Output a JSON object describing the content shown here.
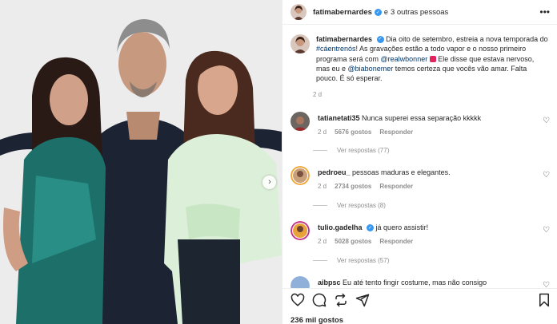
{
  "header": {
    "username": "fatimabernardes",
    "separator": "e",
    "others": "3 outras pessoas"
  },
  "caption": {
    "username": "fatimabernardes",
    "text_1": "Dia oito de setembro, estreia a nova temporada do ",
    "hashtag": "#cáentrenós",
    "text_2": "! As gravações estão a todo vapor e o nosso primeiro programa será com ",
    "mention_1": "@realwbonner",
    "text_3": " Ele disse que estava nervoso, mas eu e ",
    "mention_2": "@biabonemer",
    "text_4": " temos certeza que vocês vão amar. Falta pouco. É só esperar.",
    "time": "2 d"
  },
  "comments": [
    {
      "username": "tatianetati35",
      "text": "Nunca superei essa separação kkkkk",
      "time": "2 d",
      "likes": "5676 gostos",
      "reply": "Responder",
      "replies": "Ver respostas (77)"
    },
    {
      "username": "pedroeu_",
      "text": "pessoas maduras e elegantes.",
      "time": "2 d",
      "likes": "2734 gostos",
      "reply": "Responder",
      "replies": "Ver respostas (8)"
    },
    {
      "username": "tulio.gadelha",
      "text": "já quero assistir!",
      "time": "2 d",
      "likes": "5028 gostos",
      "reply": "Responder",
      "replies": "Ver respostas (57)"
    },
    {
      "username": "aibpsc",
      "text": "Eu até tento fingir costume, mas não consigo"
    }
  ],
  "footer": {
    "likes": "236 mil gostos"
  },
  "icons": {
    "more": "more-options-icon",
    "next": "chevron-right-icon",
    "like": "heart-icon",
    "comment": "comment-icon",
    "share": "repost-icon",
    "send": "paper-plane-icon",
    "save": "bookmark-icon",
    "verified": "verified-badge-icon"
  },
  "colors": {
    "verified": "#3897f0",
    "link": "#00376b",
    "muted": "#8e8e8e"
  }
}
